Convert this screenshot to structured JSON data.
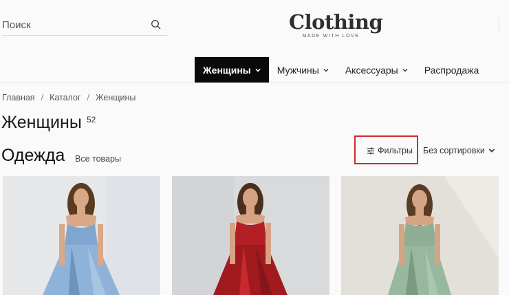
{
  "header": {
    "search": {
      "placeholder": "Поиск",
      "icon": "search-icon"
    },
    "logo": {
      "brand": "Clothing",
      "tagline": "MADE WITH LOVE"
    }
  },
  "nav": {
    "items": [
      {
        "label": "Женщины",
        "active": true,
        "has_dropdown": true
      },
      {
        "label": "Мужчины",
        "active": false,
        "has_dropdown": true
      },
      {
        "label": "Аксессуары",
        "active": false,
        "has_dropdown": true
      },
      {
        "label": "Распродажа",
        "active": false,
        "has_dropdown": false
      }
    ]
  },
  "breadcrumb": {
    "items": [
      "Главная",
      "Каталог",
      "Женщины"
    ],
    "separator": "/"
  },
  "page": {
    "title": "Женщины",
    "count": "52"
  },
  "section": {
    "title": "Одежда",
    "all_link": "Все товары",
    "filters_label": "Фильтры",
    "filters_icon": "sliders-icon",
    "sort_label": "Без сортировки",
    "highlight_color": "#d9262c"
  },
  "products": [
    {
      "dress_color": "#7fa6cf",
      "background": "#e6e7e9"
    },
    {
      "dress_color": "#b31f22",
      "background": "#d9dadc"
    },
    {
      "dress_color": "#8fae96",
      "background": "#e3e0da"
    }
  ]
}
